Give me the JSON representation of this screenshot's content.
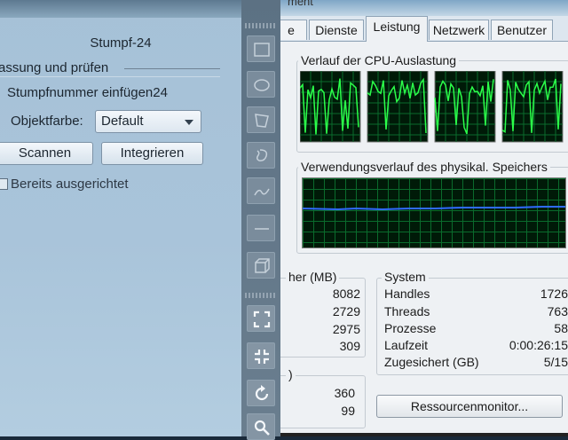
{
  "left_panel": {
    "title": "Stumpf-24",
    "section_heading": "assung und prüfen",
    "stump_number_text": "Stumpfnummer einfügen24",
    "color_label": "Objektfarbe:",
    "color_select_value": "Default",
    "scan_button": "Scannen",
    "integrate_button": "Integrieren",
    "aligned_checkbox_label": "Bereits ausgerichtet",
    "aligned_checked": false
  },
  "toolbar": {
    "tools": [
      "rectangle-tool-icon",
      "ellipse-tool-icon",
      "polygon-tool-icon",
      "lasso-tool-icon",
      "freehand-line-icon",
      "line-tool-icon",
      "box-3d-icon"
    ],
    "view_tools": [
      "fit-view-icon",
      "collapse-view-icon",
      "rotate-icon",
      "zoom-icon"
    ]
  },
  "task_manager": {
    "window_title_fragment": "ment",
    "tabs": [
      "e",
      "Dienste",
      "Leistung",
      "Netzwerk",
      "Benutzer"
    ],
    "active_tab": "Leistung",
    "cpu_history_title": "Verlauf der CPU-Auslastung",
    "memory_history_title": "Verwendungsverlauf des physikal. Speichers",
    "memory_group": {
      "title": "her (MB)",
      "values": [
        "8082",
        "2729",
        "2975",
        "309"
      ]
    },
    "kernel_group": {
      "title": ")",
      "values": [
        "360",
        "99"
      ]
    },
    "system_group": {
      "title": "System",
      "rows": [
        {
          "label": "Handles",
          "value": "1726"
        },
        {
          "label": "Threads",
          "value": "763"
        },
        {
          "label": "Prozesse",
          "value": "58"
        },
        {
          "label": "Laufzeit",
          "value": "0:00:26:15"
        },
        {
          "label": "Zugesichert (GB)",
          "value": "5/15"
        }
      ]
    },
    "resource_monitor_button": "Ressourcenmonitor...",
    "colors": {
      "cpu_line": "#2bff4a",
      "memory_line": "#2f6bff",
      "graph_grid": "#0a6b2c"
    }
  }
}
